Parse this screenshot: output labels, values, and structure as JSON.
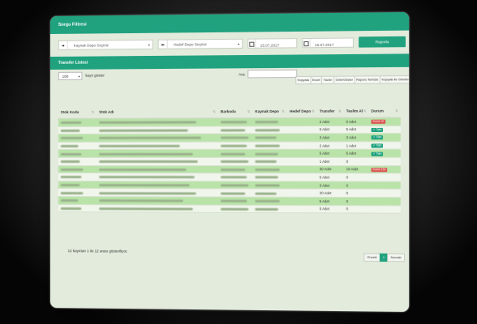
{
  "filter_card": {
    "title": "Sorgu Filtresi",
    "source_depot": "Kaynak Depo Seçiniz",
    "target_depot": "Hedef Depo Seçiniz",
    "date_start": "15.07.2017",
    "date_end": "16.07.2017",
    "report_button": "Raporla"
  },
  "list_card": {
    "title": "Transfer Listesi",
    "page_size": "100",
    "page_size_suffix": "kayıt göster",
    "search_label": "Ara:",
    "tool_buttons": [
      "Kopyala",
      "Excel",
      "Yazdır",
      "Göre/Göster",
      "Raporu Temizle",
      "Kopyala ile Gönder"
    ],
    "columns": [
      "Stok Kodu",
      "Stok Adı",
      "Barkodu",
      "Kaynak Depo",
      "Hedef Depo",
      "Transfer",
      "Teslim Al",
      "Durum"
    ],
    "rows": [
      {
        "transfer": "2 Adet",
        "teslim": "0 Adet",
        "status": "Kısmi 2x",
        "status_color": "#d9534f"
      },
      {
        "transfer": "5 Adet",
        "teslim": "5 Adet",
        "status": "✓ Tam",
        "status_color": "#20a27f"
      },
      {
        "transfer": "3 Adet",
        "teslim": "3 Adet",
        "status": "✓ Tam",
        "status_color": "#20a27f"
      },
      {
        "transfer": "2 Adet",
        "teslim": "1 Adet",
        "status": "✓ Tam",
        "status_color": "#20a27f"
      },
      {
        "transfer": "5 Adet",
        "teslim": "5 Adet",
        "status": "✓ Tam",
        "status_color": "#20a27f"
      },
      {
        "transfer": "1 Adet",
        "teslim": "0",
        "status": "",
        "status_color": ""
      },
      {
        "transfer": "30 Adet",
        "teslim": "15 Adet",
        "status": "Kısmi 15x",
        "status_color": "#d9534f"
      },
      {
        "transfer": "5 Adet",
        "teslim": "0",
        "status": "",
        "status_color": ""
      },
      {
        "transfer": "3 Adet",
        "teslim": "0",
        "status": "",
        "status_color": ""
      },
      {
        "transfer": "30 Adet",
        "teslim": "0",
        "status": "",
        "status_color": ""
      },
      {
        "transfer": "5 Adet",
        "teslim": "0",
        "status": "",
        "status_color": ""
      },
      {
        "transfer": "5 Adet",
        "teslim": "0",
        "status": "",
        "status_color": ""
      }
    ],
    "footer_info": "12 kayıttan 1 ile 12 arası gösteriliyor.",
    "pager": {
      "prev": "Önceki",
      "current": "1",
      "next": "Sonraki"
    }
  },
  "colors": {
    "accent": "#20a27f",
    "row_odd": "#b9e3a8",
    "row_even": "#f1f6ec",
    "danger": "#d9534f"
  }
}
